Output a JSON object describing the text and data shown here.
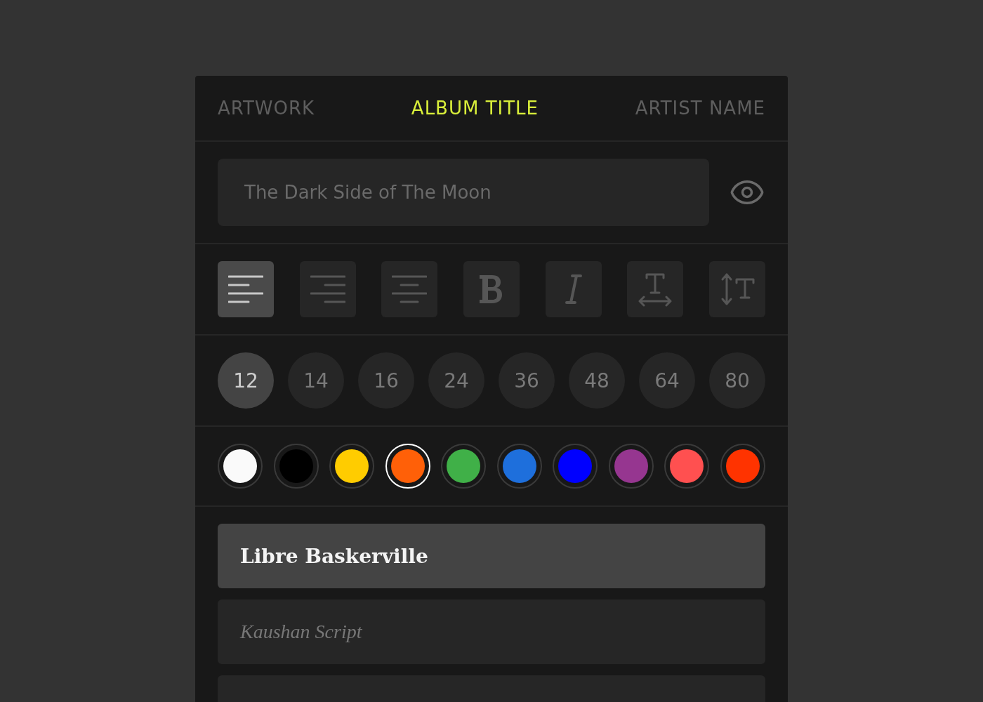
{
  "tabs": [
    {
      "label": "ARTWORK",
      "selected": false
    },
    {
      "label": "ALBUM TITLE",
      "selected": true
    },
    {
      "label": "ARTIST NAME",
      "selected": false
    }
  ],
  "title_field": {
    "value": "The Dark Side of The Moon"
  },
  "format_buttons": [
    {
      "kind": "align-left",
      "selected": true
    },
    {
      "kind": "align-right",
      "selected": false
    },
    {
      "kind": "align-center",
      "selected": false
    },
    {
      "kind": "bold",
      "selected": false
    },
    {
      "kind": "italic",
      "selected": false
    },
    {
      "kind": "letter-spacing",
      "selected": false
    },
    {
      "kind": "line-height",
      "selected": false
    }
  ],
  "font_sizes": [
    {
      "label": "12",
      "selected": true
    },
    {
      "label": "14",
      "selected": false
    },
    {
      "label": "16",
      "selected": false
    },
    {
      "label": "24",
      "selected": false
    },
    {
      "label": "36",
      "selected": false
    },
    {
      "label": "48",
      "selected": false
    },
    {
      "label": "64",
      "selected": false
    },
    {
      "label": "80",
      "selected": false
    }
  ],
  "colors": [
    {
      "color": "#fafafa",
      "selected": false
    },
    {
      "color": "#000000",
      "selected": false
    },
    {
      "color": "#ffcc00",
      "selected": false
    },
    {
      "color": "#ff6008",
      "selected": true
    },
    {
      "color": "#40b048",
      "selected": false
    },
    {
      "color": "#1e6fdc",
      "selected": false
    },
    {
      "color": "#0000ff",
      "selected": false
    },
    {
      "color": "#963690",
      "selected": false
    },
    {
      "color": "#ff5050",
      "selected": false
    },
    {
      "color": "#ff3300",
      "selected": false
    }
  ],
  "fonts": [
    {
      "name": "Libre Baskerville",
      "kind": "serif",
      "selected": true
    },
    {
      "name": "Kaushan Script",
      "kind": "script",
      "selected": false
    }
  ]
}
